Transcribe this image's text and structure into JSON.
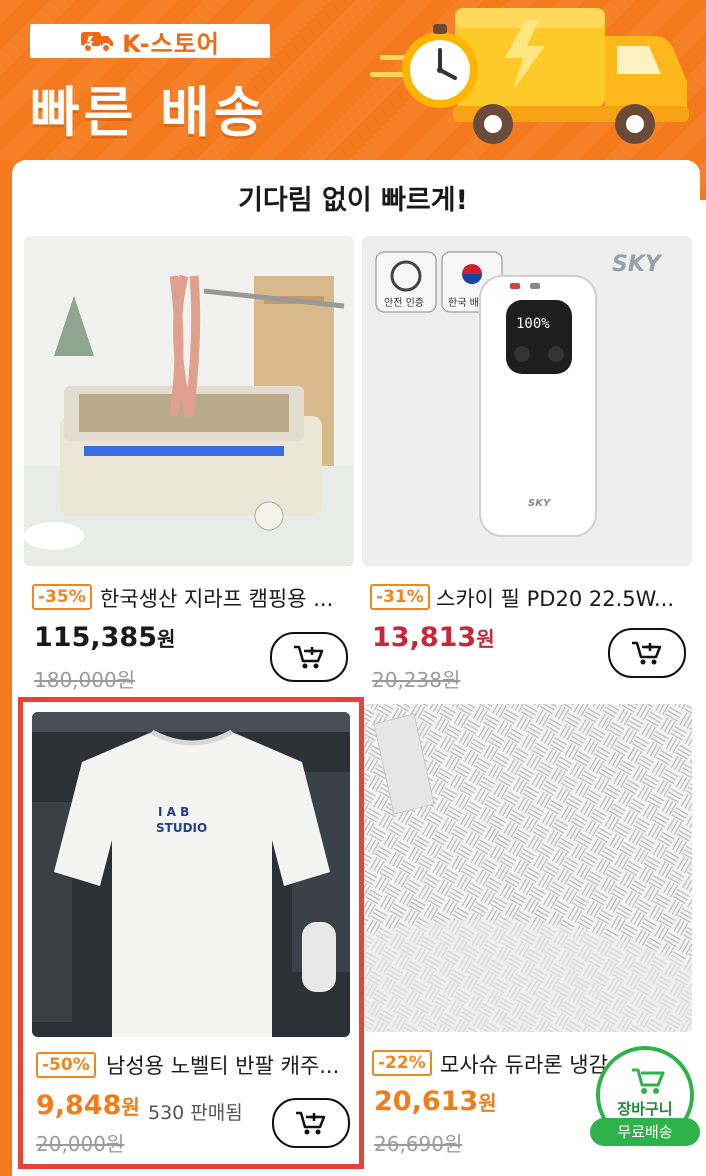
{
  "banner": {
    "store_label": "K-스토어",
    "headline": "빠른 배송"
  },
  "panel": {
    "title": "기다림 없이 빠르게!"
  },
  "products": [
    {
      "discount": "-35%",
      "name": "한국생산 지라프 캠핑용 ...",
      "price": "115,385",
      "currency": "원",
      "original_price": "180,000원",
      "price_color": "#1a1a1a"
    },
    {
      "discount": "-31%",
      "name": "스카이 필 PD20 22.5W...",
      "price": "13,813",
      "currency": "원",
      "original_price": "20,238원",
      "price_color": "#c8263a",
      "brand": "SKY",
      "badges": [
        "안전 인증",
        "한국 배송"
      ],
      "battery_readout": "100%"
    },
    {
      "discount": "-50%",
      "name": "남성용 노벨티 반팔 캐주...",
      "price": "9,848",
      "currency": "원",
      "sold": "530 판매됨",
      "original_price": "20,000원",
      "price_color": "#f07d1a",
      "shirt_print_top": "I A B",
      "shirt_print_bottom": "STUDIO"
    },
    {
      "discount": "-22%",
      "name": "모사슈 듀라론 냉감",
      "price": "20,613",
      "currency": "원",
      "original_price": "26,690원",
      "price_color": "#f07d1a"
    }
  ],
  "floating_cart": {
    "label": "장바구니",
    "free_shipping": "무료배송"
  },
  "colors": {
    "brand_orange": "#f57a1d",
    "highlight_red": "#e8423a",
    "cart_green": "#2fb24a"
  },
  "icons": [
    "truck-icon",
    "clock-icon",
    "cart-plus-icon",
    "cart-icon",
    "kc-mark-icon",
    "korea-flag-icon"
  ]
}
